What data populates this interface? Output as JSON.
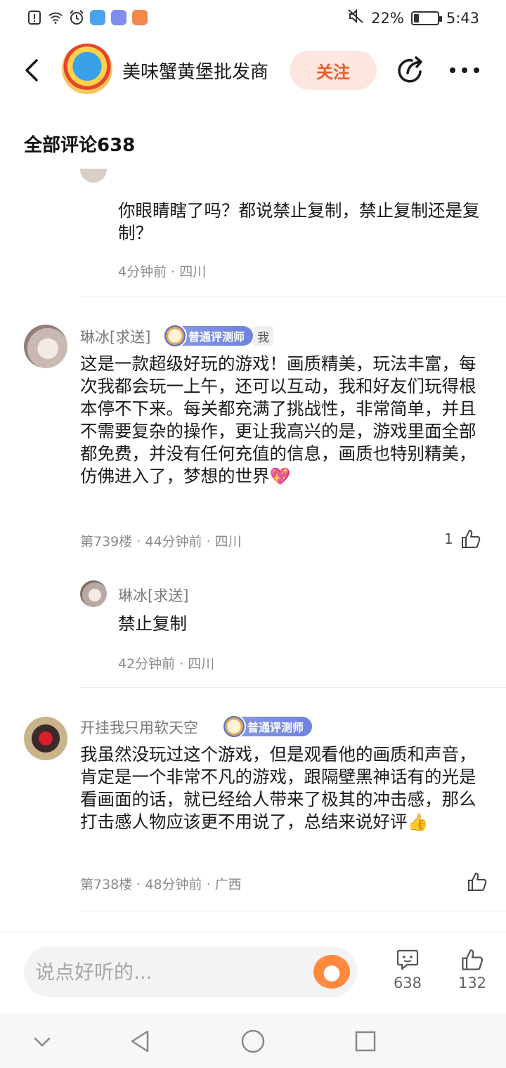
{
  "status_bar": {
    "battery_text": "22%",
    "battery_level": 0.22,
    "time": "5:43",
    "icons": [
      "alert-icon",
      "wifi-icon",
      "alarm-icon",
      "app-shield-icon",
      "app-music-icon",
      "app-video-icon",
      "mute-icon",
      "battery-icon"
    ],
    "colors": {
      "shield": "#4aa3f0",
      "music": "#7f8cf0",
      "video": "#f2884b"
    }
  },
  "header": {
    "author_name": "美味蟹黄堡批发商",
    "follow_label": "关注"
  },
  "section": {
    "title": "全部评论638"
  },
  "comments": [
    {
      "reply": true,
      "text": "你眼睛瞎了吗？都说禁止复制，禁止复制还是复制？",
      "meta": "4分钟前 · 四川"
    },
    {
      "username": "琳冰[求送]",
      "badge": "普通评测师",
      "me_tag": "我",
      "text": "这是一款超级好玩的游戏！画质精美，玩法丰富，每次我都会玩一上午，还可以互动，我和好友们玩得根本停不下来。每关都充满了挑战性，非常简单，并且不需要复杂的操作，更让我高兴的是，游戏里面全部都免费，并没有任何充值的信息，画质也特别精美，仿佛进入了，梦想的世界",
      "emoji": "💖",
      "meta": "第739楼 · 44分钟前 · 四川",
      "likes": "1"
    },
    {
      "reply": true,
      "username": "琳冰[求送]",
      "text": "禁止复制",
      "meta": "42分钟前 · 四川"
    },
    {
      "username": "开挂我只用软天空",
      "badge": "普通评测师",
      "text": "我虽然没玩过这个游戏，但是观看他的画质和声音，肯定是一个非常不凡的游戏，跟隔壁黑神话有的光是看画面的话，就已经给人带来了极其的冲击感，那么打击感人物应该更不用说了，总结来说好评",
      "emoji": "👍",
      "meta": "第738楼 · 48分钟前 · 广西",
      "likes": ""
    }
  ],
  "bottom_bar": {
    "input_placeholder": "说点好听的...",
    "comment_count": "638",
    "like_count": "132"
  },
  "accent_color": "#ef5b2e"
}
